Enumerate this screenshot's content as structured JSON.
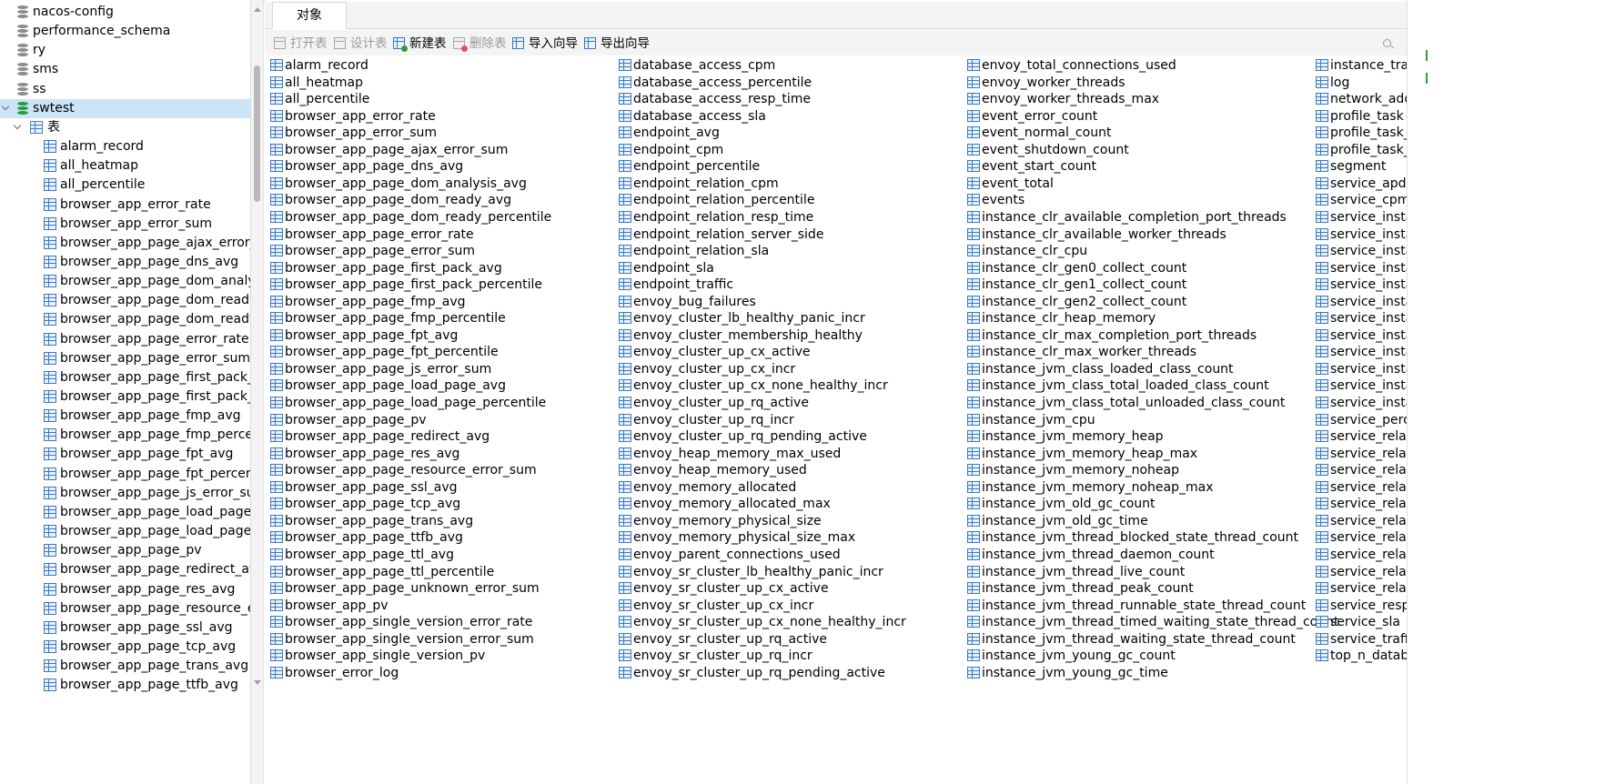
{
  "sidebar": {
    "databases": [
      {
        "name": "nacos-config"
      },
      {
        "name": "performance_schema"
      },
      {
        "name": "ry"
      },
      {
        "name": "sms"
      },
      {
        "name": "ss"
      },
      {
        "name": "swtest",
        "open": true,
        "selected": true
      }
    ],
    "tables_node": "表",
    "tables": [
      "alarm_record",
      "all_heatmap",
      "all_percentile",
      "browser_app_error_rate",
      "browser_app_error_sum",
      "browser_app_page_ajax_error_su",
      "browser_app_page_dns_avg",
      "browser_app_page_dom_analysi",
      "browser_app_page_dom_ready_",
      "browser_app_page_dom_ready_",
      "browser_app_page_error_rate",
      "browser_app_page_error_sum",
      "browser_app_page_first_pack_av",
      "browser_app_page_first_pack_pe",
      "browser_app_page_fmp_avg",
      "browser_app_page_fmp_percent",
      "browser_app_page_fpt_avg",
      "browser_app_page_fpt_percenti",
      "browser_app_page_js_error_sum",
      "browser_app_page_load_page_a",
      "browser_app_page_load_page_p",
      "browser_app_page_pv",
      "browser_app_page_redirect_avg",
      "browser_app_page_res_avg",
      "browser_app_page_resource_err",
      "browser_app_page_ssl_avg",
      "browser_app_page_tcp_avg",
      "browser_app_page_trans_avg",
      "browser_app_page_ttfb_avg"
    ]
  },
  "tabs": [
    {
      "label": "对象"
    }
  ],
  "toolbar": {
    "open": "打开表",
    "design": "设计表",
    "new": "新建表",
    "delete": "删除表",
    "import": "导入向导",
    "export": "导出向导"
  },
  "objects": {
    "col1": [
      "alarm_record",
      "all_heatmap",
      "all_percentile",
      "browser_app_error_rate",
      "browser_app_error_sum",
      "browser_app_page_ajax_error_sum",
      "browser_app_page_dns_avg",
      "browser_app_page_dom_analysis_avg",
      "browser_app_page_dom_ready_avg",
      "browser_app_page_dom_ready_percentile",
      "browser_app_page_error_rate",
      "browser_app_page_error_sum",
      "browser_app_page_first_pack_avg",
      "browser_app_page_first_pack_percentile",
      "browser_app_page_fmp_avg",
      "browser_app_page_fmp_percentile",
      "browser_app_page_fpt_avg",
      "browser_app_page_fpt_percentile",
      "browser_app_page_js_error_sum",
      "browser_app_page_load_page_avg",
      "browser_app_page_load_page_percentile",
      "browser_app_page_pv",
      "browser_app_page_redirect_avg",
      "browser_app_page_res_avg",
      "browser_app_page_resource_error_sum",
      "browser_app_page_ssl_avg",
      "browser_app_page_tcp_avg",
      "browser_app_page_trans_avg",
      "browser_app_page_ttfb_avg",
      "browser_app_page_ttl_avg",
      "browser_app_page_ttl_percentile",
      "browser_app_page_unknown_error_sum",
      "browser_app_pv",
      "browser_app_single_version_error_rate",
      "browser_app_single_version_error_sum",
      "browser_app_single_version_pv",
      "browser_error_log"
    ],
    "col2": [
      "database_access_cpm",
      "database_access_percentile",
      "database_access_resp_time",
      "database_access_sla",
      "endpoint_avg",
      "endpoint_cpm",
      "endpoint_percentile",
      "endpoint_relation_cpm",
      "endpoint_relation_percentile",
      "endpoint_relation_resp_time",
      "endpoint_relation_server_side",
      "endpoint_relation_sla",
      "endpoint_sla",
      "endpoint_traffic",
      "envoy_bug_failures",
      "envoy_cluster_lb_healthy_panic_incr",
      "envoy_cluster_membership_healthy",
      "envoy_cluster_up_cx_active",
      "envoy_cluster_up_cx_incr",
      "envoy_cluster_up_cx_none_healthy_incr",
      "envoy_cluster_up_rq_active",
      "envoy_cluster_up_rq_incr",
      "envoy_cluster_up_rq_pending_active",
      "envoy_heap_memory_max_used",
      "envoy_heap_memory_used",
      "envoy_memory_allocated",
      "envoy_memory_allocated_max",
      "envoy_memory_physical_size",
      "envoy_memory_physical_size_max",
      "envoy_parent_connections_used",
      "envoy_sr_cluster_lb_healthy_panic_incr",
      "envoy_sr_cluster_up_cx_active",
      "envoy_sr_cluster_up_cx_incr",
      "envoy_sr_cluster_up_cx_none_healthy_incr",
      "envoy_sr_cluster_up_rq_active",
      "envoy_sr_cluster_up_rq_incr",
      "envoy_sr_cluster_up_rq_pending_active"
    ],
    "col3": [
      "envoy_total_connections_used",
      "envoy_worker_threads",
      "envoy_worker_threads_max",
      "event_error_count",
      "event_normal_count",
      "event_shutdown_count",
      "event_start_count",
      "event_total",
      "events",
      "instance_clr_available_completion_port_threads",
      "instance_clr_available_worker_threads",
      "instance_clr_cpu",
      "instance_clr_gen0_collect_count",
      "instance_clr_gen1_collect_count",
      "instance_clr_gen2_collect_count",
      "instance_clr_heap_memory",
      "instance_clr_max_completion_port_threads",
      "instance_clr_max_worker_threads",
      "instance_jvm_class_loaded_class_count",
      "instance_jvm_class_total_loaded_class_count",
      "instance_jvm_class_total_unloaded_class_count",
      "instance_jvm_cpu",
      "instance_jvm_memory_heap",
      "instance_jvm_memory_heap_max",
      "instance_jvm_memory_noheap",
      "instance_jvm_memory_noheap_max",
      "instance_jvm_old_gc_count",
      "instance_jvm_old_gc_time",
      "instance_jvm_thread_blocked_state_thread_count",
      "instance_jvm_thread_daemon_count",
      "instance_jvm_thread_live_count",
      "instance_jvm_thread_peak_count",
      "instance_jvm_thread_runnable_state_thread_count",
      "instance_jvm_thread_timed_waiting_state_thread_count",
      "instance_jvm_thread_waiting_state_thread_count",
      "instance_jvm_young_gc_count",
      "instance_jvm_young_gc_time"
    ],
    "col4": [
      "instance_traff",
      "log",
      "network_add",
      "profile_task",
      "profile_task_l",
      "profile_task_s",
      "segment",
      "service_apde",
      "service_cpm",
      "service_instar",
      "service_instar",
      "service_instar",
      "service_instar",
      "service_instar",
      "service_instar",
      "service_instar",
      "service_instar",
      "service_instar",
      "service_instar",
      "service_instar",
      "service_instar",
      "service_perce",
      "service_relati",
      "service_relati",
      "service_relati",
      "service_relati",
      "service_relati",
      "service_relati",
      "service_relati",
      "service_relati",
      "service_relati",
      "service_relati",
      "service_resp_",
      "service_sla",
      "service_traffi",
      "top_n_databa"
    ]
  },
  "colors": {
    "selection": "#cce4f7",
    "table_icon": "#3a79c3",
    "db_active": "#2e9b3a",
    "db_inactive": "#8c8c8c"
  }
}
